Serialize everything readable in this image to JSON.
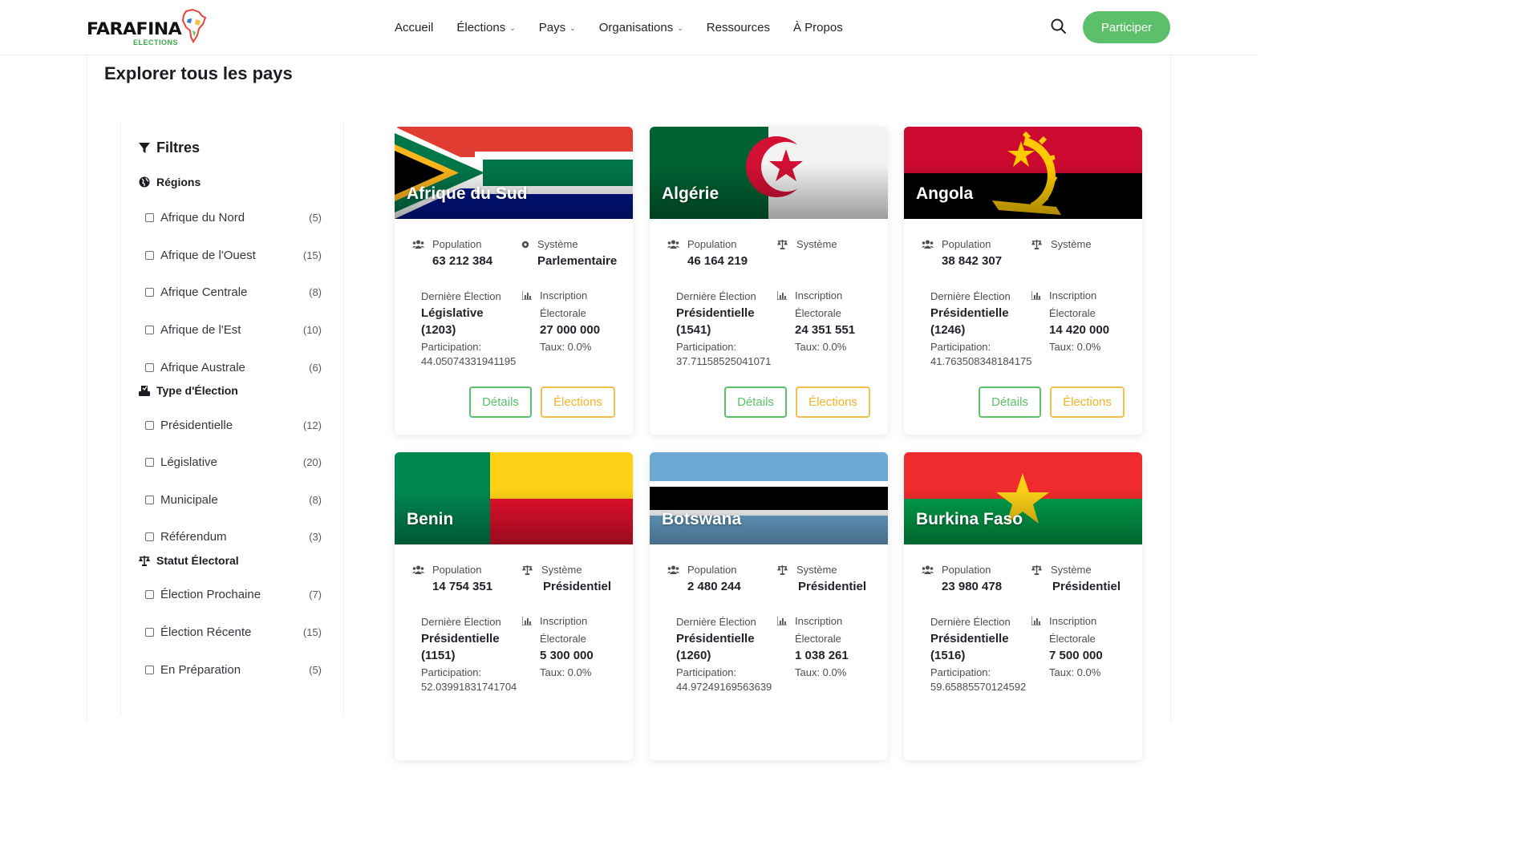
{
  "brand": {
    "name": "FARAFINA",
    "sub": "ELECTIONS"
  },
  "nav": {
    "items": [
      {
        "label": "Accueil",
        "dropdown": false
      },
      {
        "label": "Élections",
        "dropdown": true
      },
      {
        "label": "Pays",
        "dropdown": true
      },
      {
        "label": "Organisations",
        "dropdown": true
      },
      {
        "label": "Ressources",
        "dropdown": false
      },
      {
        "label": "À Propos",
        "dropdown": false
      }
    ],
    "cta": "Participer"
  },
  "page": {
    "title": "Explorer tous les pays"
  },
  "filters": {
    "title": "Filtres",
    "groups": [
      {
        "title": "Régions",
        "icon": "globe-icon",
        "options": [
          {
            "label": "Afrique du Nord",
            "count": "(5)"
          },
          {
            "label": "Afrique de l'Ouest",
            "count": "(15)"
          },
          {
            "label": "Afrique Centrale",
            "count": "(8)"
          },
          {
            "label": "Afrique de l'Est",
            "count": "(10)"
          },
          {
            "label": "Afrique Australe",
            "count": "(6)"
          }
        ]
      },
      {
        "title": "Type d'Élection",
        "icon": "ballot-box-icon",
        "options": [
          {
            "label": "Présidentielle",
            "count": "(12)"
          },
          {
            "label": "Législative",
            "count": "(20)"
          },
          {
            "label": "Municipale",
            "count": "(8)"
          },
          {
            "label": "Référendum",
            "count": "(3)"
          }
        ]
      },
      {
        "title": "Statut Électoral",
        "icon": "scale-icon",
        "options": [
          {
            "label": "Élection Prochaine",
            "count": "(7)"
          },
          {
            "label": "Élection Récente",
            "count": "(15)"
          },
          {
            "label": "En Préparation",
            "count": "(5)"
          }
        ]
      }
    ]
  },
  "labels": {
    "population": "Population",
    "system": "Système",
    "last_election": "Dernière Élection",
    "registration_1": "Inscription",
    "registration_2": "Électorale",
    "participation": "Participation:",
    "details": "Détails",
    "elections": "Élections"
  },
  "countries": [
    {
      "name": "Afrique du Sud",
      "flag": "south-africa",
      "population": "63 212 384",
      "system": "Parlementaire",
      "election_type": "Législative",
      "election_year": "(1203)",
      "participation": "44.05074331941195",
      "registered": "27 000 000",
      "rate": "Taux: 0.0%"
    },
    {
      "name": "Algérie",
      "flag": "algeria",
      "population": "46 164 219",
      "system": "",
      "election_type": "Présidentielle",
      "election_year": "(1541)",
      "participation": "37.71158525041071",
      "registered": "24 351 551",
      "rate": "Taux: 0.0%"
    },
    {
      "name": "Angola",
      "flag": "angola",
      "population": "38 842 307",
      "system": "",
      "election_type": "Présidentielle",
      "election_year": "(1246)",
      "participation": "41.763508348184175",
      "registered": "14 420 000",
      "rate": "Taux: 0.0%"
    },
    {
      "name": "Benin",
      "flag": "benin",
      "population": "14 754 351",
      "system": "Présidentiel",
      "election_type": "Présidentielle",
      "election_year": "(1151)",
      "participation": "52.03991831741704",
      "registered": "5 300 000",
      "rate": "Taux: 0.0%"
    },
    {
      "name": "Botswana",
      "flag": "botswana",
      "population": "2 480 244",
      "system": "Présidentiel",
      "election_type": "Présidentielle",
      "election_year": "(1260)",
      "participation": "44.97249169563639",
      "registered": "1 038 261",
      "rate": "Taux: 0.0%"
    },
    {
      "name": "Burkina Faso",
      "flag": "burkina-faso",
      "population": "23 980 478",
      "system": "Présidentiel",
      "election_type": "Présidentielle",
      "election_year": "(1516)",
      "participation": "59.65885570124592",
      "registered": "7 500 000",
      "rate": "Taux: 0.0%"
    }
  ],
  "colors": {
    "primary": "#5cc06a",
    "secondary": "#f5c04a"
  }
}
